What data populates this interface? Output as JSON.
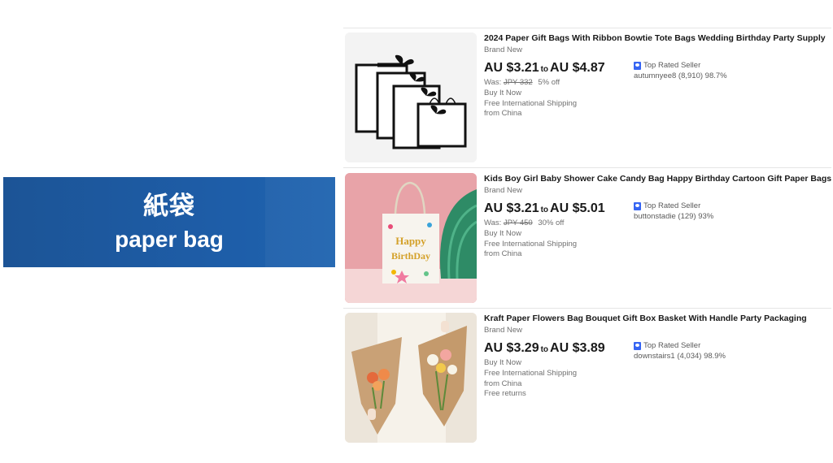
{
  "banner": {
    "title": "紙袋",
    "subtitle": "paper bag"
  },
  "listings": [
    {
      "title": "2024 Paper Gift Bags With Ribbon Bowtie Tote Bags Wedding Birthday Party Supply",
      "condition": "Brand New",
      "price_low": "AU $3.21",
      "price_to": "to",
      "price_high": "AU $4.87",
      "was_label": "Was:",
      "was_price": "JPY 332",
      "discount": "5% off",
      "format": "Buy It Now",
      "shipping": "Free International Shipping",
      "location": "from China",
      "badge": "Top Rated Seller",
      "seller": "autumnyee8 (8,910) 98.7%",
      "image_icon": "white-gift-bags-with-black-ribbon"
    },
    {
      "title": "Kids Boy Girl Baby Shower Cake Candy Bag Happy Birthday Cartoon Gift Paper Bags",
      "condition": "Brand New",
      "price_low": "AU $3.21",
      "price_to": "to",
      "price_high": "AU $5.01",
      "was_label": "Was:",
      "was_price": "JPY 450",
      "discount": "30% off",
      "format": "Buy It Now",
      "shipping": "Free International Shipping",
      "location": "from China",
      "badge": "Top Rated Seller",
      "seller": "buttonstadie (129) 93%",
      "image_icon": "happy-birthday-paper-bag",
      "image_text": [
        "Happy",
        "BirthDay"
      ]
    },
    {
      "title": "Kraft Paper Flowers Bag Bouquet Gift Box Basket With Handle Party Packaging",
      "condition": "Brand New",
      "price_low": "AU $3.29",
      "price_to": "to",
      "price_high": "AU $3.89",
      "format": "Buy It Now",
      "shipping": "Free International Shipping",
      "location": "from China",
      "returns": "Free returns",
      "badge": "Top Rated Seller",
      "seller": "downstairs1 (4,034) 98.9%",
      "image_icon": "kraft-flower-bouquet-bags"
    }
  ],
  "colors": {
    "banner": "#1e5ea9",
    "badge": "#3665f3",
    "text": "#191919",
    "muted": "#707070"
  }
}
